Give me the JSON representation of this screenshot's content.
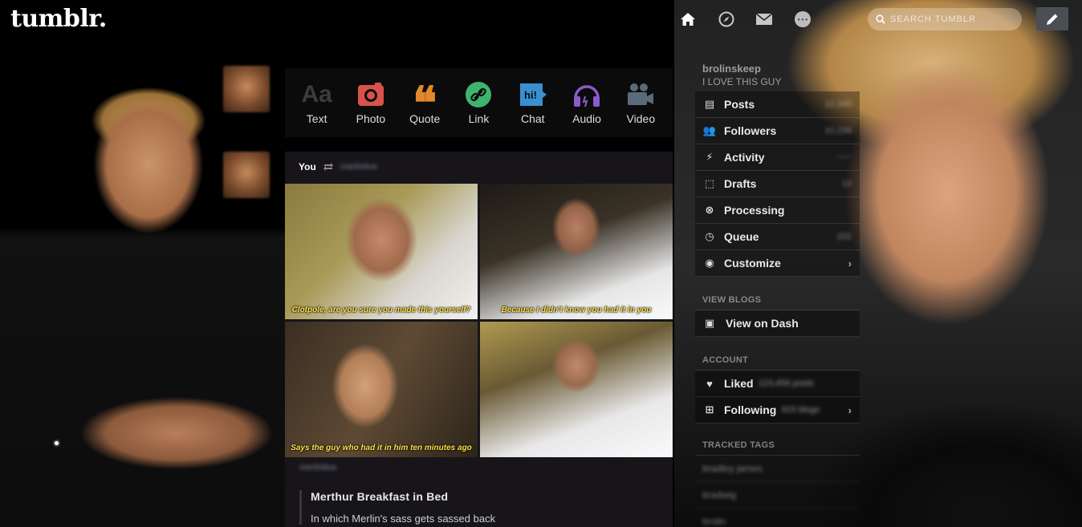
{
  "header": {
    "logo": "tumblr.",
    "nav_icons": [
      "home-icon",
      "explore-compass-icon",
      "inbox-envelope-icon",
      "messaging-icon"
    ],
    "search": {
      "placeholder": "SEARCH TUMBLR"
    },
    "compose_icon": "pencil-icon"
  },
  "post_types": [
    {
      "label": "Text",
      "icon": "Aa",
      "color": "#3c3c3c"
    },
    {
      "label": "Photo",
      "icon": "camera",
      "color": "#d9534a"
    },
    {
      "label": "Quote",
      "icon": "❝",
      "color": "#e4892a"
    },
    {
      "label": "Link",
      "icon": "link",
      "color": "#3fb46e"
    },
    {
      "label": "Chat",
      "icon": "hi!",
      "color": "#3a8fd1"
    },
    {
      "label": "Audio",
      "icon": "headphones",
      "color": "#8b5bc9"
    },
    {
      "label": "Video",
      "icon": "camcorder",
      "color": "#5a6a78"
    }
  ],
  "post": {
    "author": "You",
    "reblogged_from": "merlinlive",
    "photos": [
      {
        "caption": "Clotpole, are you sure you made this yourself?"
      },
      {
        "caption": "Because I didn't know you had it in you"
      },
      {
        "caption": "Says the guy who had it in him ten minutes ago"
      },
      {
        "caption": ""
      }
    ],
    "source": "merlinlive",
    "title": "Merthur Breakfast in Bed",
    "description": "In which Merlin's sass gets sassed back"
  },
  "sidebar": {
    "blog_name": "brolinskeep",
    "blog_title": "I LOVE THIS GUY",
    "items": [
      {
        "label": "Posts",
        "icon": "posts-icon",
        "count": "12,345"
      },
      {
        "label": "Followers",
        "icon": "followers-icon",
        "count": "10,234"
      },
      {
        "label": "Activity",
        "icon": "activity-icon",
        "count": "~~~"
      },
      {
        "label": "Drafts",
        "icon": "drafts-icon",
        "count": "12"
      },
      {
        "label": "Processing",
        "icon": "processing-icon",
        "count": ""
      },
      {
        "label": "Queue",
        "icon": "queue-icon",
        "count": "102"
      },
      {
        "label": "Customize",
        "icon": "eye-icon",
        "count": ""
      }
    ],
    "view_blogs_heading": "VIEW BLOGS",
    "view_on_dash": "View on Dash",
    "account_heading": "ACCOUNT",
    "liked_label": "Liked",
    "liked_count": "123,456 posts",
    "following_label": "Following",
    "following_count": "915 blogs",
    "tracked_tags_heading": "TRACKED TAGS",
    "tags": [
      "bradley james",
      "bradwig",
      "brolin"
    ]
  }
}
